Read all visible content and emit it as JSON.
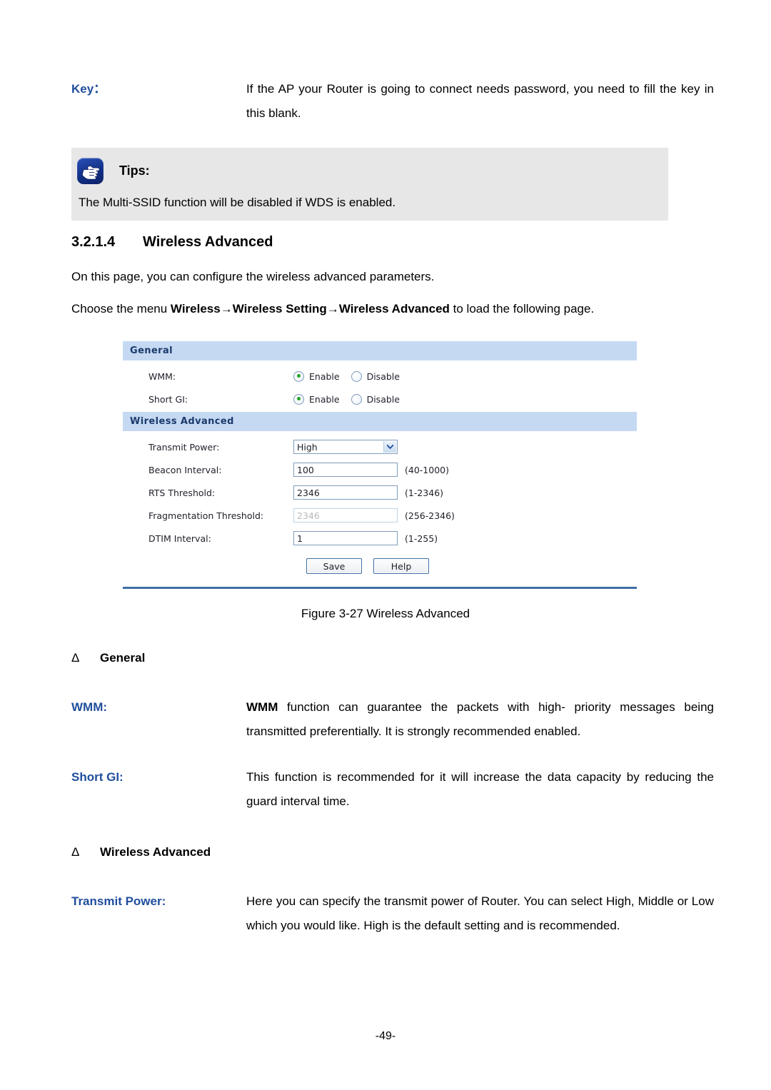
{
  "doc": {
    "page_number": "-49-",
    "accent_blue": "#1f4e9c",
    "panel_header_bg": "#c5d9f3",
    "panel_header_text": "#1b3a6b",
    "radio_on_color": "#26a32b"
  },
  "key_entry": {
    "term": "Key：",
    "description": "If the AP your Router is going to connect needs password, you need to fill the key in this blank."
  },
  "tips": {
    "icon": "pointing-hand-icon",
    "label": "Tips:",
    "body": "The Multi-SSID function will be disabled if WDS is enabled."
  },
  "section": {
    "number": "3.2.1.4",
    "title": "Wireless Advanced",
    "intro": "On this page, you can configure the wireless advanced parameters.",
    "menu_lead": "Choose the menu ",
    "menu_path_1": "Wireless",
    "menu_arrow_1": "→",
    "menu_path_2": "Wireless Setting",
    "menu_arrow_2": "→",
    "menu_path_3": "Wireless Advanced",
    "menu_tail": " to load the following page."
  },
  "router_ui": {
    "general": {
      "header": "General",
      "rows": [
        {
          "label": "WMM:",
          "options": [
            "Enable",
            "Disable"
          ],
          "selected": "Enable"
        },
        {
          "label": "Short GI:",
          "options": [
            "Enable",
            "Disable"
          ],
          "selected": "Enable"
        }
      ]
    },
    "wireless_advanced": {
      "header": "Wireless Advanced",
      "transmit_power": {
        "label": "Transmit Power:",
        "value": "High",
        "options": [
          "High",
          "Middle",
          "Low"
        ]
      },
      "fields": [
        {
          "label": "Beacon Interval:",
          "value": "100",
          "hint": "(40-1000)",
          "disabled": false
        },
        {
          "label": "RTS Threshold:",
          "value": "2346",
          "hint": "(1-2346)",
          "disabled": false
        },
        {
          "label": "Fragmentation Threshold:",
          "value": "2346",
          "hint": "(256-2346)",
          "disabled": true
        },
        {
          "label": "DTIM Interval:",
          "value": "1",
          "hint": "(1-255)",
          "disabled": false
        }
      ],
      "buttons": [
        {
          "label": "Save"
        },
        {
          "label": "Help"
        }
      ]
    }
  },
  "figure": {
    "caption": "Figure 3-27 Wireless Advanced"
  },
  "descriptions": {
    "bullet_mark": "Δ",
    "general_heading": "General",
    "wireless_advanced_heading": "Wireless Advanced",
    "wmm": {
      "term": "WMM:",
      "lead_bold": "WMM",
      "description": " function can guarantee the packets with high- priority messages being transmitted preferentially. It is strongly recommended enabled."
    },
    "short_gi": {
      "term": "Short GI:",
      "description": "This function is recommended for it will increase the data capacity by reducing the guard interval time."
    },
    "transmit_power": {
      "term": "Transmit Power:",
      "description": "Here you can specify the transmit power of Router. You can select High, Middle or Low which you would like. High is the default setting and is recommended."
    }
  }
}
